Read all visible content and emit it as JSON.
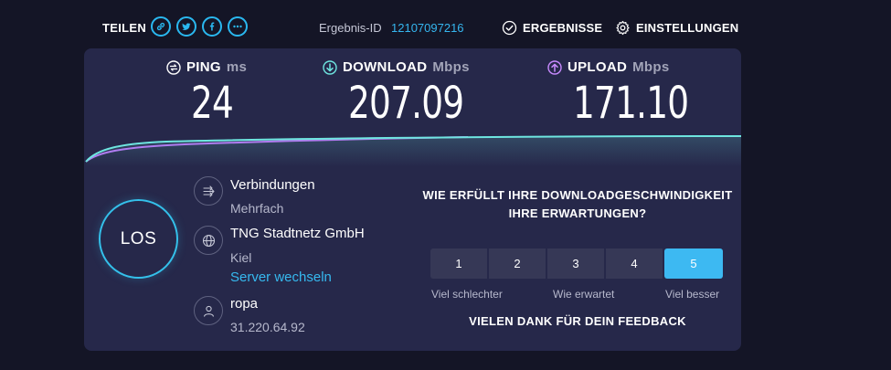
{
  "colors": {
    "background": "#141526",
    "panel": "#26284a",
    "accent": "#35b6ef",
    "download_accent": "#6ee6e0",
    "upload_accent": "#c88aff",
    "rating_selected": "#3db9f2"
  },
  "header": {
    "share_label": "TEILEN",
    "share_icons": [
      "link-icon",
      "twitter-icon",
      "facebook-icon",
      "more-icon"
    ],
    "result_id_label": "Ergebnis-ID",
    "result_id_value": "12107097216",
    "results_label": "ERGEBNISSE",
    "settings_label": "EINSTELLUNGEN"
  },
  "metrics": {
    "ping": {
      "label": "PING",
      "unit": "ms",
      "value": "24",
      "icon": "ping-icon"
    },
    "download": {
      "label": "DOWNLOAD",
      "unit": "Mbps",
      "value": "207.09",
      "icon": "download-arrow-icon"
    },
    "upload": {
      "label": "UPLOAD",
      "unit": "Mbps",
      "value": "171.10",
      "icon": "upload-arrow-icon"
    }
  },
  "go_button": {
    "label": "LOS"
  },
  "connections": {
    "title": "Verbindungen",
    "value": "Mehrfach",
    "icon": "connections-icon"
  },
  "server": {
    "name": "TNG Stadtnetz GmbH",
    "location": "Kiel",
    "change_link": "Server wechseln",
    "icon": "globe-icon"
  },
  "user": {
    "provider": "ropa",
    "ip": "31.220.64.92",
    "icon": "user-icon"
  },
  "feedback": {
    "question": "WIE ERFÜLLT IHRE DOWNLOADGESCHWINDIGKEIT IHRE ERWARTUNGEN?",
    "options": [
      "1",
      "2",
      "3",
      "4",
      "5"
    ],
    "selected": "5",
    "scale_low": "Viel schlechter",
    "scale_mid": "Wie erwartet",
    "scale_high": "Viel besser",
    "thanks": "VIELEN DANK FÜR DEIN FEEDBACK"
  }
}
